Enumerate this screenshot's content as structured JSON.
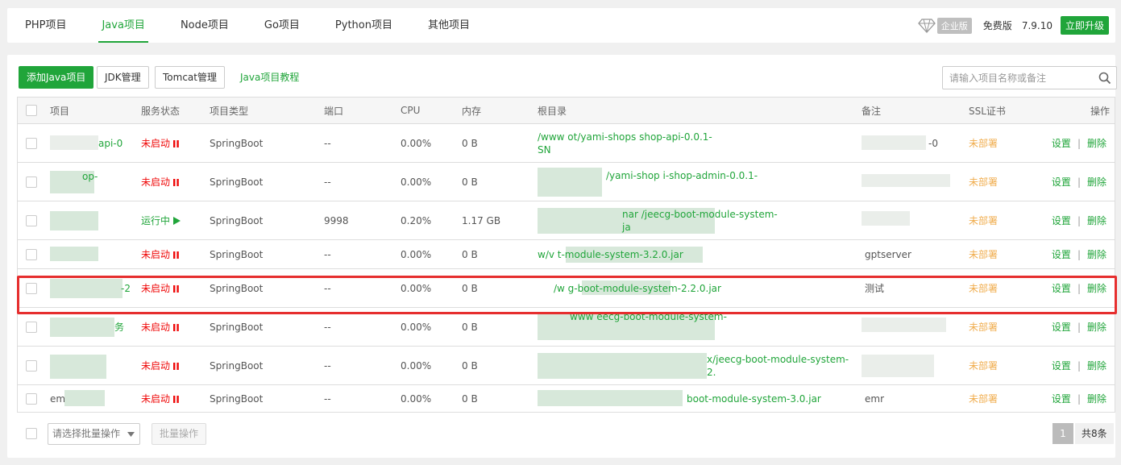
{
  "tabs": [
    {
      "label": "PHP项目",
      "active": false
    },
    {
      "label": "Java项目",
      "active": true
    },
    {
      "label": "Node项目",
      "active": false
    },
    {
      "label": "Go项目",
      "active": false
    },
    {
      "label": "Python项目",
      "active": false
    },
    {
      "label": "其他项目",
      "active": false
    }
  ],
  "topright": {
    "enterprise_badge": "企业版",
    "free_label": "免费版",
    "version": "7.9.10",
    "upgrade_label": "立即升级"
  },
  "toolbar": {
    "add_label": "添加Java项目",
    "jdk_label": "JDK管理",
    "tomcat_label": "Tomcat管理",
    "tutorial_label": "Java项目教程",
    "search_placeholder": "请输入项目名称或备注"
  },
  "headers": {
    "name": "项目",
    "status": "服务状态",
    "type": "项目类型",
    "port": "端口",
    "cpu": "CPU",
    "mem": "内存",
    "root": "根目录",
    "remark": "备注",
    "ssl": "SSL证书",
    "ops": "操作"
  },
  "rows": [
    {
      "name": "api-0",
      "status": "未启动",
      "running": false,
      "type": "SpringBoot",
      "port": "--",
      "cpu": "0.00%",
      "mem": "0 B",
      "root": "/www ot/yami-shops shop-api-0.0.1-",
      "root2": "SN",
      "remark": "-0",
      "ssl": "未部署",
      "set": "设置",
      "del": "删除"
    },
    {
      "name": "op-",
      "status": "未启动",
      "running": false,
      "type": "SpringBoot",
      "port": "--",
      "cpu": "0.00%",
      "mem": "0 B",
      "root": "/yami-shop i-shop-admin-0.0.1-",
      "root2": "",
      "remark": "",
      "ssl": "未部署",
      "set": "设置",
      "del": "删除"
    },
    {
      "name": "",
      "status": "运行中",
      "running": true,
      "type": "SpringBoot",
      "port": "9998",
      "cpu": "0.20%",
      "mem": "1.17 GB",
      "root": "nar /jeecg-boot-module-system-",
      "root2": "ja",
      "remark": "",
      "ssl": "未部署",
      "set": "设置",
      "del": "删除"
    },
    {
      "name": "",
      "status": "未启动",
      "running": false,
      "type": "SpringBoot",
      "port": "--",
      "cpu": "0.00%",
      "mem": "0 B",
      "root": "w/v t-module-system-3.2.0.jar",
      "root2": "",
      "remark": "gptserver",
      "ssl": "未部署",
      "set": "设置",
      "del": "删除"
    },
    {
      "name": "-2",
      "status": "未启动",
      "running": false,
      "type": "SpringBoot",
      "port": "--",
      "cpu": "0.00%",
      "mem": "0 B",
      "root": "/w g-boot-module-system-2.2.0.jar",
      "root2": "",
      "remark": "测试",
      "ssl": "未部署",
      "set": "设置",
      "del": "删除"
    },
    {
      "name": "务",
      "status": "未启动",
      "running": false,
      "type": "SpringBoot",
      "port": "--",
      "cpu": "0.00%",
      "mem": "0 B",
      "root": "www eecg-boot-module-system-",
      "root2": "",
      "remark": "",
      "ssl": "未部署",
      "set": "设置",
      "del": "删除"
    },
    {
      "name": "",
      "status": "未启动",
      "running": false,
      "type": "SpringBoot",
      "port": "--",
      "cpu": "0.00%",
      "mem": "0 B",
      "root": "x/jeecg-boot-module-system-",
      "root2": "2.",
      "remark": "",
      "ssl": "未部署",
      "set": "设置",
      "del": "删除"
    },
    {
      "name": "em",
      "status": "未启动",
      "running": false,
      "type": "SpringBoot",
      "port": "--",
      "cpu": "0.00%",
      "mem": "0 B",
      "root": "boot-module-system-3.0.jar",
      "root2": "",
      "remark": "emr",
      "ssl": "未部署",
      "set": "设置",
      "del": "删除"
    }
  ],
  "footer": {
    "batch_placeholder": "请选择批量操作",
    "batch_btn": "批量操作",
    "page": "1",
    "total": "共8条"
  },
  "colors": {
    "accent": "#20a53a",
    "stopped": "#ef0808",
    "ssl": "#f0ad4e",
    "highlight": "#e62e2e"
  }
}
